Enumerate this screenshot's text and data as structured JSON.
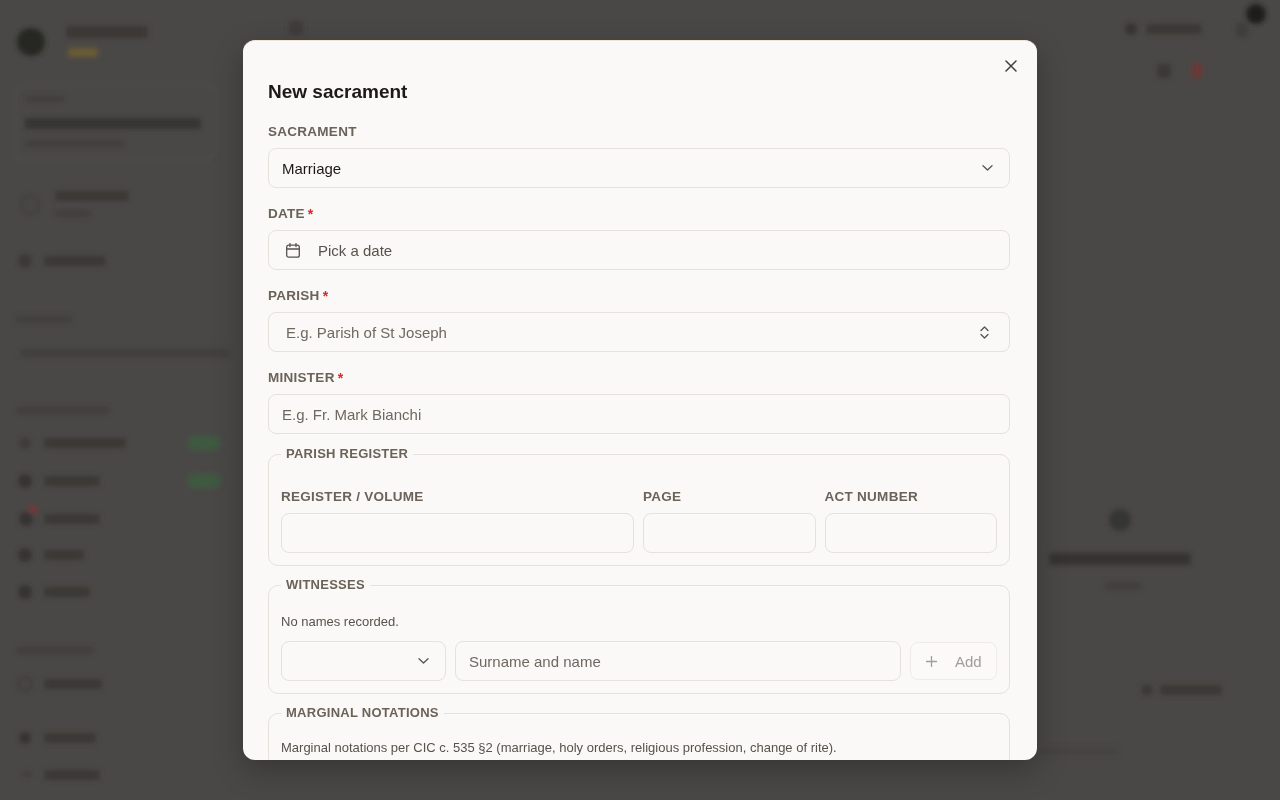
{
  "dialog": {
    "title": "New sacrament"
  },
  "fields": [
    {
      "kind": "select",
      "label": "SACRAMENT",
      "value": "Marriage"
    },
    {
      "kind": "date",
      "label": "DATE",
      "required_mark": "*",
      "placeholder": "Pick a date"
    },
    {
      "kind": "combobox",
      "label": "PARISH",
      "required_mark": "*",
      "placeholder": "E.g. Parish of St Joseph"
    },
    {
      "kind": "text",
      "label": "MINISTER",
      "required_mark": "*",
      "placeholder": "E.g. Fr. Mark Bianchi"
    }
  ],
  "parish_register": {
    "legend": "PARISH REGISTER",
    "fields": [
      {
        "label": "REGISTER / VOLUME"
      },
      {
        "label": "PAGE"
      },
      {
        "label": "ACT NUMBER"
      }
    ]
  },
  "witnesses": {
    "legend": "WITNESSES",
    "empty_text": "No names recorded.",
    "name_field": {
      "placeholder": "Surname and name"
    },
    "add_button": {
      "label": "Add",
      "disabled": true
    }
  },
  "marginal_notations": {
    "legend": "MARGINAL NOTATIONS",
    "description": "Marginal notations per CIC c. 535 §2 (marriage, holy orders, religious profession, change of rite)."
  }
}
